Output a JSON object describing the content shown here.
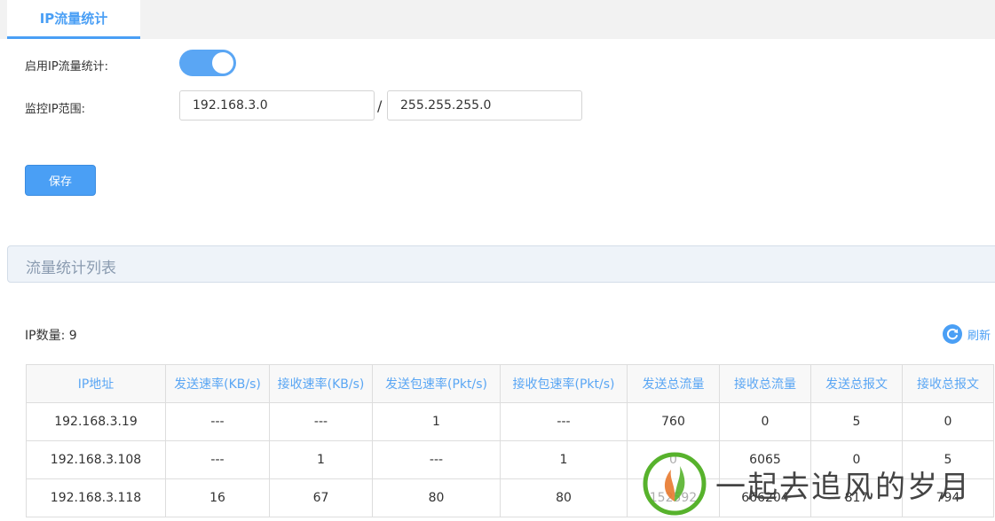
{
  "tab": {
    "label": "IP流量统计"
  },
  "form": {
    "enable_label": "启用IP流量统计:",
    "enable_on": true,
    "range_label": "监控IP范围:",
    "ip_value": "192.168.3.0",
    "mask_value": "255.255.255.0",
    "separator": "/",
    "save_label": "保存"
  },
  "section": {
    "title": "流量统计列表"
  },
  "list": {
    "ip_count_label": "IP数量: 9",
    "refresh_label": "刷新",
    "columns": [
      "IP地址",
      "发送速率(KB/s)",
      "接收速率(KB/s)",
      "发送包速率(Pkt/s)",
      "接收包速率(Pkt/s)",
      "发送总流量",
      "接收总流量",
      "发送总报文",
      "接收总报文"
    ],
    "rows": [
      [
        "192.168.3.19",
        "---",
        "---",
        "1",
        "---",
        "760",
        "0",
        "5",
        "0"
      ],
      [
        "192.168.3.108",
        "---",
        "1",
        "---",
        "1",
        "0",
        "6065",
        "0",
        "5"
      ],
      [
        "192.168.3.118",
        "16",
        "67",
        "80",
        "80",
        "152592",
        "666204",
        "817",
        "794"
      ]
    ]
  },
  "colors": {
    "accent": "#4a9ff5",
    "header_text": "#5aa6f4",
    "section_bg": "#eef3f9"
  },
  "watermark": {
    "text": "一起去追风的岁月"
  }
}
